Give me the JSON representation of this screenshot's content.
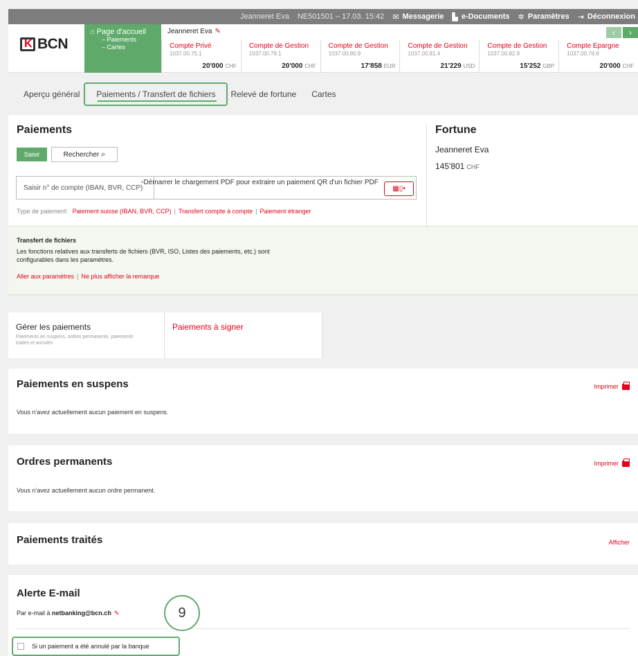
{
  "topbar": {
    "user": "Jeanneret Eva",
    "contract": "NE501501 – 17.03. 15:42",
    "messagerie": "Messagerie",
    "edocuments": "e-Documents",
    "parametres": "Paramètres",
    "deconnexion": "Déconnexion"
  },
  "logo": {
    "text": "BCN"
  },
  "home": {
    "title": "Page d'accueil",
    "sub1": "– Paiements",
    "sub2": "– Cartes"
  },
  "owner": {
    "name": "Jeanneret Eva"
  },
  "accounts": [
    {
      "name": "Compte Privé",
      "iban": "1037.00.75.1",
      "balance": "20'000",
      "currency": "CHF"
    },
    {
      "name": "Compte de Gestion",
      "iban": "1037.00.79.1",
      "balance": "20'000",
      "currency": "CHF"
    },
    {
      "name": "Compte de Gestion",
      "iban": "1037.00.80.9",
      "balance": "17'858",
      "currency": "EUR"
    },
    {
      "name": "Compte de Gestion",
      "iban": "1037.00.81.4",
      "balance": "21'229",
      "currency": "USD"
    },
    {
      "name": "Compte de Gestion",
      "iban": "1037.00.82.9",
      "balance": "15'252",
      "currency": "GBP"
    },
    {
      "name": "Compte Epargne",
      "iban": "1037.00.76.6",
      "balance": "20'000",
      "currency": "CHF"
    }
  ],
  "tabs": {
    "apercu": "Aperçu général",
    "paiements": "Paiements / Transfert de fichiers",
    "releve": "Relevé de fortune",
    "cartes": "Cartes"
  },
  "payments": {
    "title": "Paiements",
    "saisir": "Saisir",
    "rechercher": "Rechercher",
    "account_placeholder": "Saisir n° de compte (IBAN, BVR, CCP)",
    "pdf_text": "Démarrer le chargement PDF pour extraire un paiement QR d'un fichier PDF",
    "type_label": "Type de paiement:",
    "type_suisse": "Paiement suisse (IBAN, BVR, CCP)",
    "type_compte": "Transfert compte à compte",
    "type_etranger": "Paiement étranger"
  },
  "fortune": {
    "title": "Fortune",
    "name": "Jeanneret Eva",
    "amount": "145'801",
    "currency": "CHF"
  },
  "notice": {
    "title": "Transfert de fichiers",
    "text": "Les fonctions relatives aux transferts de fichiers (BVR, ISO, Listes des paiements, etc.) sont configurables dans les paramètres.",
    "link1": "Aller aux paramètres",
    "link2": "Ne plus afficher la remarque"
  },
  "subtabs": {
    "gerer_title": "Gérer les paiements",
    "gerer_desc": "Paiements en suspens, ordres permanents, paiements traités et annulés",
    "signer_title": "Paiements à signer"
  },
  "suspens": {
    "title": "Paiements en suspens",
    "print": "Imprimer",
    "message": "Vous n'avez actuellement aucun paiement en suspens."
  },
  "ordres": {
    "title": "Ordres permanents",
    "print": "Imprimer",
    "message": "Vous n'avez actuellement aucun ordre permanent."
  },
  "traites": {
    "title": "Paiements traités",
    "afficher": "Afficher"
  },
  "alerte": {
    "title": "Alerte E-mail",
    "prefix": "Par e-mail à",
    "email": "netbanking@bcn.ch",
    "checkbox_label": "Si un paiement a été annulé par la banque"
  },
  "callout": {
    "number": "9"
  },
  "colors": {
    "brand_green": "#5faa6a",
    "brand_red": "#e2001a",
    "topbar_gray": "#7d7d7d"
  }
}
